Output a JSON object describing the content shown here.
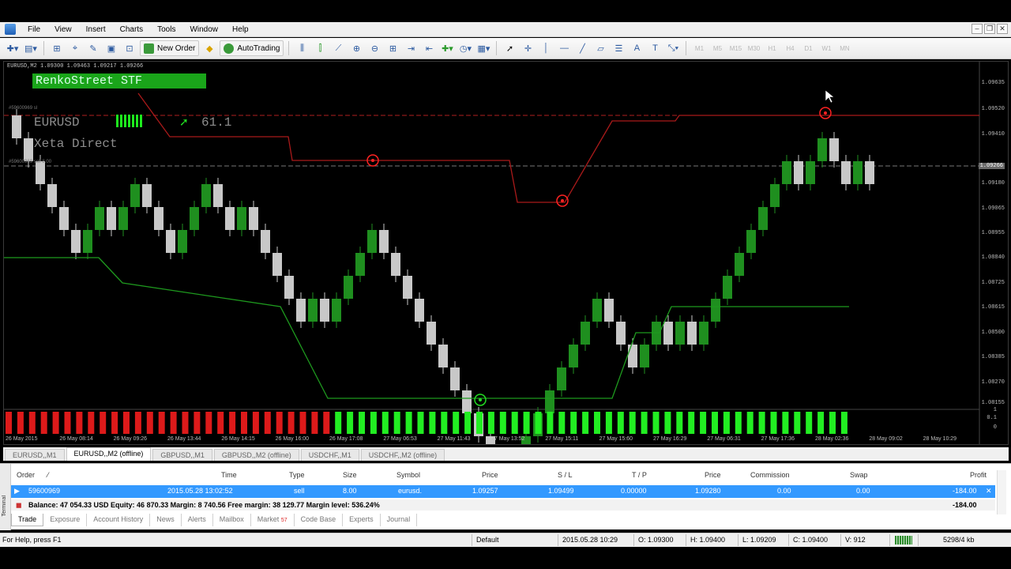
{
  "menu": [
    "File",
    "View",
    "Insert",
    "Charts",
    "Tools",
    "Window",
    "Help"
  ],
  "toolbar": {
    "new_order": "New Order",
    "autotrading": "AutoTrading",
    "timeframes": [
      "M1",
      "M5",
      "M15",
      "M30",
      "H1",
      "H4",
      "D1",
      "W1",
      "MN"
    ]
  },
  "chart": {
    "symbol_info": "EURUSD,M2 1.09300 1.09463 1.09217 1.09266",
    "brand": "RenkoStreet STF",
    "pair": "EURUSD",
    "value": "61.1",
    "broker": "Xeta Direct",
    "order_tag": "#59600969 sl",
    "order_tag2": "#59600969 sell 8.00",
    "price_labels": [
      "1.09635",
      "1.09520",
      "1.09410",
      "1.09266",
      "1.09180",
      "1.09065",
      "1.08955",
      "1.08840",
      "1.08725",
      "1.08615",
      "1.08500",
      "1.08385",
      "1.08270",
      "1.08155"
    ],
    "current_price": "1.09266",
    "time_labels": [
      "26 May 2015",
      "26 May 08:14",
      "26 May 09:26",
      "26 May 13:44",
      "26 May 14:15",
      "26 May 16:00",
      "26 May 17:08",
      "27 May 06:53",
      "27 May 11:43",
      "27 May 13:52",
      "27 May 15:11",
      "27 May 15:60",
      "27 May 16:29",
      "27 May 06:31",
      "27 May 17:36",
      "28 May 02:36",
      "28 May 09:02",
      "28 May 10:29"
    ],
    "sub_labels": [
      "1",
      "0.1",
      "0"
    ]
  },
  "chart_tabs": [
    "EURUSD,,M1",
    "EURUSD,,M2 (offline)",
    "GBPUSD,,M1",
    "GBPUSD,,M2 (offline)",
    "USDCHF,,M1",
    "USDCHF,,M2 (offline)"
  ],
  "terminal": {
    "side_label": "Terminal",
    "headers": {
      "order": "Order",
      "time": "Time",
      "type": "Type",
      "size": "Size",
      "symbol": "Symbol",
      "price": "Price",
      "sl": "S / L",
      "tp": "T / P",
      "price2": "Price",
      "commission": "Commission",
      "swap": "Swap",
      "profit": "Profit"
    },
    "row": {
      "order": "59600969",
      "time": "2015.05.28 13:02:52",
      "type": "sell",
      "size": "8.00",
      "symbol": "eurusd.",
      "price": "1.09257",
      "sl": "1.09499",
      "tp": "0.00000",
      "price2": "1.09280",
      "commission": "0.00",
      "swap": "0.00",
      "profit": "-184.00"
    },
    "balance_line": "Balance: 47 054.33 USD  Equity: 46 870.33  Margin: 8 740.56  Free margin: 38 129.77  Margin level: 536.24%",
    "balance_profit": "-184.00",
    "tabs": [
      "Trade",
      "Exposure",
      "Account History",
      "News",
      "Alerts",
      "Mailbox",
      "Market",
      "Code Base",
      "Experts",
      "Journal"
    ],
    "market_badge": "57"
  },
  "status": {
    "help": "For Help, press F1",
    "profile": "Default",
    "datetime": "2015.05.28 10:29",
    "open": "O: 1.09300",
    "high": "H: 1.09400",
    "low": "L: 1.09209",
    "close": "C: 1.09400",
    "volume": "V: 912",
    "traffic": "5298/4 kb"
  }
}
